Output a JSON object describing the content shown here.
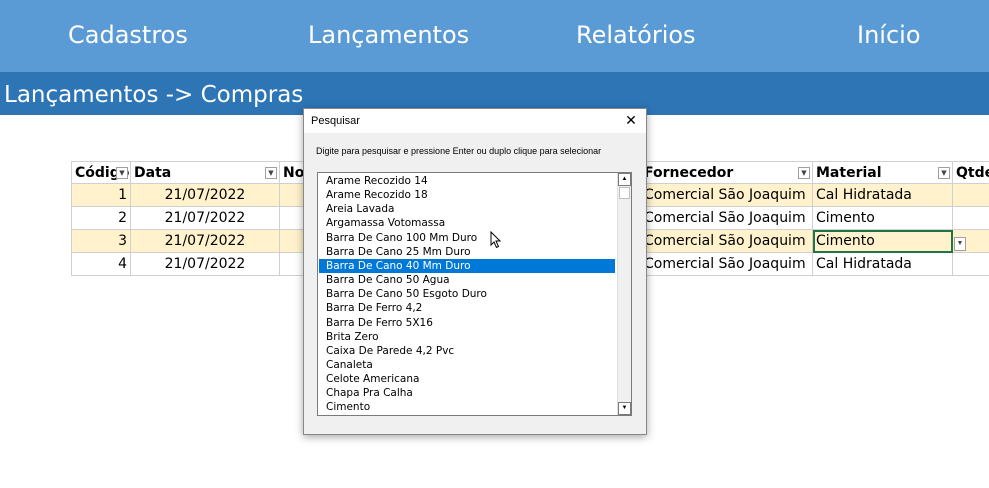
{
  "nav": {
    "items": [
      {
        "label": "Cadastros"
      },
      {
        "label": "Lançamentos"
      },
      {
        "label": "Relatórios"
      },
      {
        "label": "Início"
      }
    ]
  },
  "subtitle": "Lançamentos -> Compras",
  "table": {
    "headers": {
      "codigo": "Código",
      "data": "Data",
      "nome": "No",
      "fornecedor": "Fornecedor",
      "material": "Material",
      "qtde": "Qtde"
    },
    "rows": [
      {
        "codigo": "1",
        "data": "21/07/2022",
        "fornecedor": "Comercial São Joaquim",
        "material": "Cal Hidratada"
      },
      {
        "codigo": "2",
        "data": "21/07/2022",
        "fornecedor": "Comercial São Joaquim",
        "material": "Cimento"
      },
      {
        "codigo": "3",
        "data": "21/07/2022",
        "fornecedor": "Comercial São Joaquim",
        "material": "Cimento"
      },
      {
        "codigo": "4",
        "data": "21/07/2022",
        "fornecedor": "Comercial São Joaquim",
        "material": "Cal Hidratada"
      }
    ]
  },
  "dialog": {
    "title": "Pesquisar",
    "close": "✕",
    "instruction": "Digite para pesquisar e pressione Enter ou duplo clique para selecionar",
    "items": [
      "Arame Recozido 14",
      "Arame Recozido 18",
      "Areia Lavada",
      "Argamassa Votomassa",
      "Barra De Cano 100 Mm Duro",
      "Barra De Cano 25 Mm Duro",
      "Barra De Cano 40 Mm Duro",
      "Barra De Cano 50 Agua",
      "Barra De Cano 50 Esgoto Duro",
      "Barra De Ferro 4,2",
      "Barra De Ferro 5X16",
      "Brita Zero",
      "Caixa De Parede 4,2 Pvc",
      "Canaleta",
      "Celote Americana",
      "Chapa Pra Calha",
      "Cimento"
    ],
    "selected_index": 6
  },
  "colors": {
    "nav_bg": "#5b9bd5",
    "subbar_bg": "#2e75b6",
    "row_band": "#fff2cc",
    "selection": "#0078d7"
  }
}
